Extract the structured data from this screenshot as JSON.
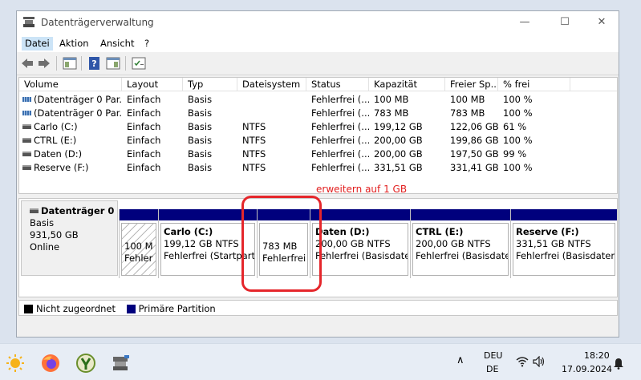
{
  "window": {
    "title": "Datenträgerverwaltung",
    "minimize_glyph": "—",
    "maximize_glyph": "☐",
    "close_glyph": "✕"
  },
  "menu": [
    "Datei",
    "Aktion",
    "Ansicht",
    "?"
  ],
  "volume_table": {
    "columns": [
      "Volume",
      "Layout",
      "Typ",
      "Dateisystem",
      "Status",
      "Kapazität",
      "Freier Sp...",
      "% frei"
    ],
    "rows": [
      {
        "volume": "(Datenträger 0 Par...",
        "layout": "Einfach",
        "typ": "Basis",
        "fs": "",
        "status": "Fehlerfrei (...",
        "kapazitaet": "100 MB",
        "frei": "100 MB",
        "prozent": "100 %",
        "icon": "striped-disk-icon"
      },
      {
        "volume": "(Datenträger 0 Par...",
        "layout": "Einfach",
        "typ": "Basis",
        "fs": "",
        "status": "Fehlerfrei (...",
        "kapazitaet": "783 MB",
        "frei": "783 MB",
        "prozent": "100 %",
        "icon": "striped-disk-icon"
      },
      {
        "volume": "Carlo (C:)",
        "layout": "Einfach",
        "typ": "Basis",
        "fs": "NTFS",
        "status": "Fehlerfrei (...",
        "kapazitaet": "199,12 GB",
        "frei": "122,06 GB",
        "prozent": "61 %",
        "icon": "drive-icon"
      },
      {
        "volume": "CTRL (E:)",
        "layout": "Einfach",
        "typ": "Basis",
        "fs": "NTFS",
        "status": "Fehlerfrei (...",
        "kapazitaet": "200,00 GB",
        "frei": "199,86 GB",
        "prozent": "100 %",
        "icon": "drive-icon"
      },
      {
        "volume": "Daten (D:)",
        "layout": "Einfach",
        "typ": "Basis",
        "fs": "NTFS",
        "status": "Fehlerfrei (...",
        "kapazitaet": "200,00 GB",
        "frei": "197,50 GB",
        "prozent": "99 %",
        "icon": "drive-icon"
      },
      {
        "volume": "Reserve (F:)",
        "layout": "Einfach",
        "typ": "Basis",
        "fs": "NTFS",
        "status": "Fehlerfrei (...",
        "kapazitaet": "331,51 GB",
        "frei": "331,41 GB",
        "prozent": "100 %",
        "icon": "drive-icon"
      }
    ]
  },
  "annotation": "erweitern auf 1 GB",
  "disk": {
    "name": "Datenträger 0",
    "type": "Basis",
    "size": "931,50 GB",
    "state": "Online"
  },
  "partitions": [
    {
      "name": "",
      "size": "100 M",
      "status": "Fehler"
    },
    {
      "name": "Carlo  (C:)",
      "size": "199,12 GB NTFS",
      "status": "Fehlerfrei (Startpart"
    },
    {
      "name": "",
      "size": "783 MB",
      "status": "Fehlerfrei"
    },
    {
      "name": "Daten  (D:)",
      "size": "200,00 GB NTFS",
      "status": "Fehlerfrei (Basisdater"
    },
    {
      "name": "CTRL  (E:)",
      "size": "200,00 GB NTFS",
      "status": "Fehlerfrei (Basisdater"
    },
    {
      "name": "Reserve  (F:)",
      "size": "331,51 GB NTFS",
      "status": "Fehlerfrei (Basisdaten"
    }
  ],
  "legend": [
    {
      "label": "Nicht zugeordnet",
      "color": "#000000"
    },
    {
      "label": "Primäre Partition",
      "color": "#00007d"
    }
  ],
  "taskbar": {
    "language_top": "DEU",
    "language_bottom": "DE",
    "time": "18:20",
    "date": "17.09.2024",
    "chevron_glyph": "∧"
  },
  "colors": {
    "primary_partition": "#00007d",
    "annotation_red": "#e21e1e"
  }
}
